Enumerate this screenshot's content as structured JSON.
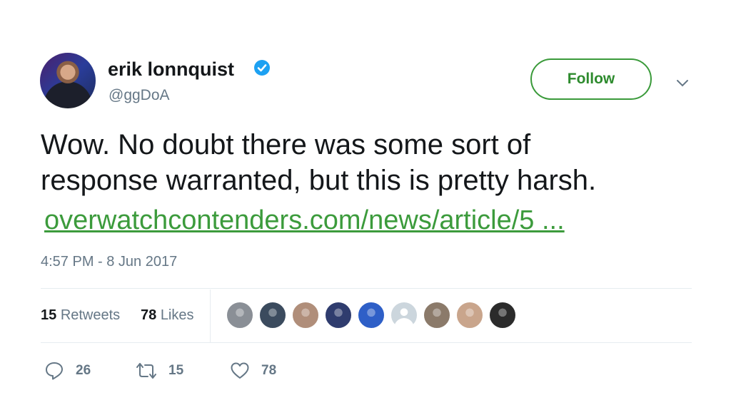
{
  "author": {
    "display_name": "erik lonnquist",
    "handle": "@ggDoA",
    "verified": true
  },
  "follow_button": {
    "label": "Follow"
  },
  "tweet": {
    "text_line1": "Wow. No doubt there was some sort of",
    "text_line2": "response warranted, but this is pretty harsh.",
    "link_text": "overwatchcontenders.com/news/article/5 ...",
    "timestamp": "4:57 PM - 8 Jun 2017"
  },
  "stats": {
    "retweets_count": "15",
    "retweets_label": "Retweets",
    "likes_count": "78",
    "likes_label": "Likes"
  },
  "actions": {
    "replies": "26",
    "retweets": "15",
    "likes": "78"
  },
  "likers": [
    {
      "icon": "liker-avatar-1",
      "color": "#8a8f96"
    },
    {
      "icon": "liker-avatar-2",
      "color": "#3b4b5e"
    },
    {
      "icon": "liker-avatar-3",
      "color": "#b08e7a"
    },
    {
      "icon": "liker-avatar-4",
      "color": "#2f3c6e"
    },
    {
      "icon": "liker-avatar-5",
      "color": "#2e5fc7"
    },
    {
      "icon": "default-avatar",
      "color": "#ccd6dd"
    },
    {
      "icon": "liker-avatar-7",
      "color": "#8b7a6a"
    },
    {
      "icon": "liker-avatar-8",
      "color": "#c9a58c"
    },
    {
      "icon": "liker-avatar-9",
      "color": "#2b2b2b"
    }
  ],
  "colors": {
    "link_green": "#3c9b3c",
    "verified_blue": "#1da1f2",
    "muted_text": "#657786"
  }
}
